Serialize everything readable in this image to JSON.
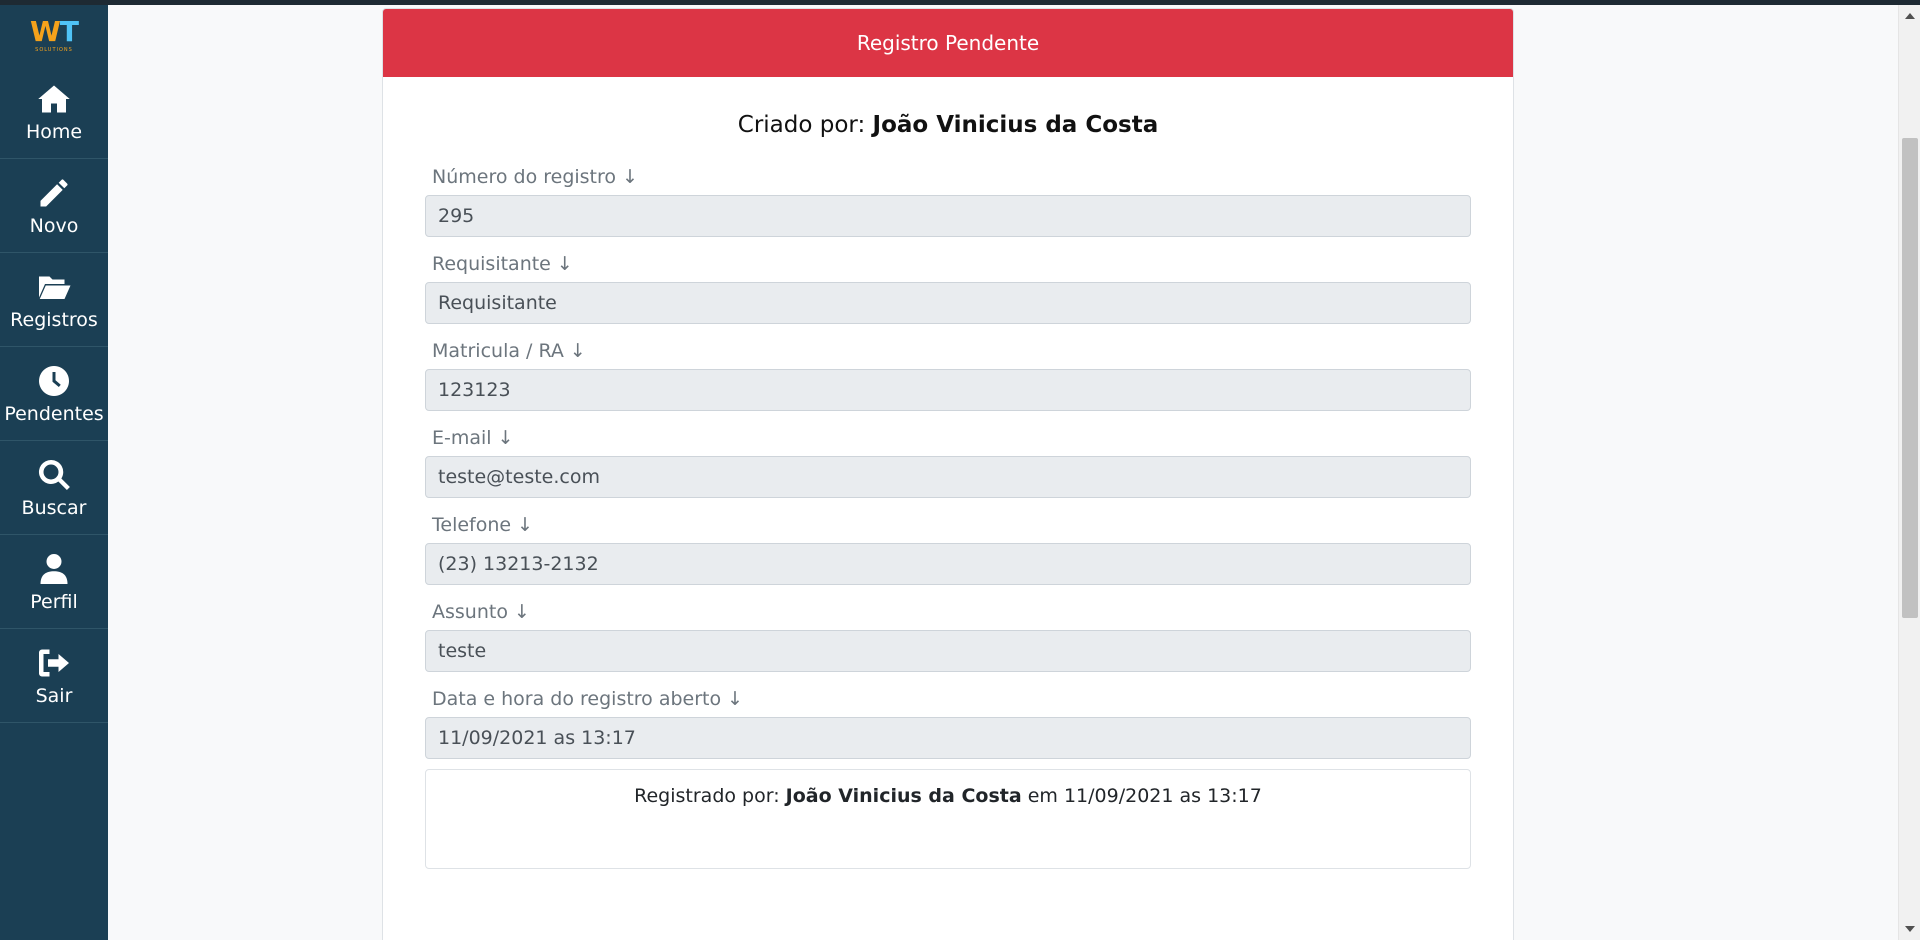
{
  "sidebar": {
    "logo": {
      "text_w": "W",
      "text_t": "T",
      "sub": "SOLUTIONS"
    },
    "items": [
      {
        "label": "Home",
        "icon": "home-icon"
      },
      {
        "label": "Novo",
        "icon": "pencil-icon"
      },
      {
        "label": "Registros",
        "icon": "folder-open-icon"
      },
      {
        "label": "Pendentes",
        "icon": "clock-icon"
      },
      {
        "label": "Buscar",
        "icon": "search-icon"
      },
      {
        "label": "Perfil",
        "icon": "user-icon"
      },
      {
        "label": "Sair",
        "icon": "sign-out-icon"
      }
    ]
  },
  "card": {
    "header": "Registro Pendente",
    "created_by_label": "Criado por: ",
    "created_by_name": "João Vinicius da Costa"
  },
  "fields": [
    {
      "label": "Número do registro ↓",
      "value": "295"
    },
    {
      "label": "Requisitante ↓",
      "value": "Requisitante"
    },
    {
      "label": "Matricula / RA ↓",
      "value": "123123"
    },
    {
      "label": "E-mail ↓",
      "value": "teste@teste.com"
    },
    {
      "label": "Telefone ↓",
      "value": "(23) 13213-2132"
    },
    {
      "label": "Assunto ↓",
      "value": "teste"
    },
    {
      "label": "Data e hora do registro aberto ↓",
      "value": "11/09/2021 as 13:17"
    }
  ],
  "registered": {
    "prefix": "Registrado por: ",
    "name": "João Vinicius da Costa",
    "suffix": " em 11/09/2021 as 13:17"
  },
  "colors": {
    "sidebar": "#1b3f54",
    "header": "#dc3545",
    "input_bg": "#e9ecef"
  }
}
